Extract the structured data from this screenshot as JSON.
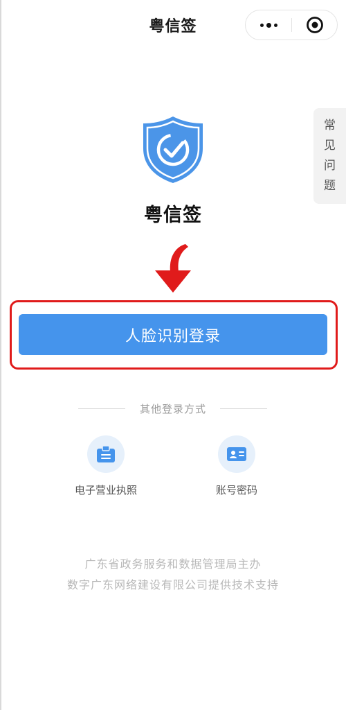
{
  "header": {
    "title": "粤信签",
    "capsule": {
      "more_icon": "more-dots-icon",
      "close_icon": "record-target-icon"
    }
  },
  "faq_tab": {
    "chars": [
      "常",
      "见",
      "问",
      "题"
    ]
  },
  "logo": {
    "icon": "shield-check-icon",
    "name": "粤信签"
  },
  "annotation": {
    "arrow_icon": "red-down-arrow-icon",
    "highlight_color": "#e01b1b"
  },
  "login": {
    "face_button_label": "人脸识别登录",
    "button_color": "#4594ec"
  },
  "other_methods": {
    "title": "其他登录方式",
    "items": [
      {
        "label": "电子营业执照",
        "icon": "business-license-icon"
      },
      {
        "label": "账号密码",
        "icon": "account-card-icon"
      }
    ]
  },
  "footer": {
    "line1": "广东省政务服务和数据管理局主办",
    "line2": "数字广东网络建设有限公司提供技术支持"
  }
}
